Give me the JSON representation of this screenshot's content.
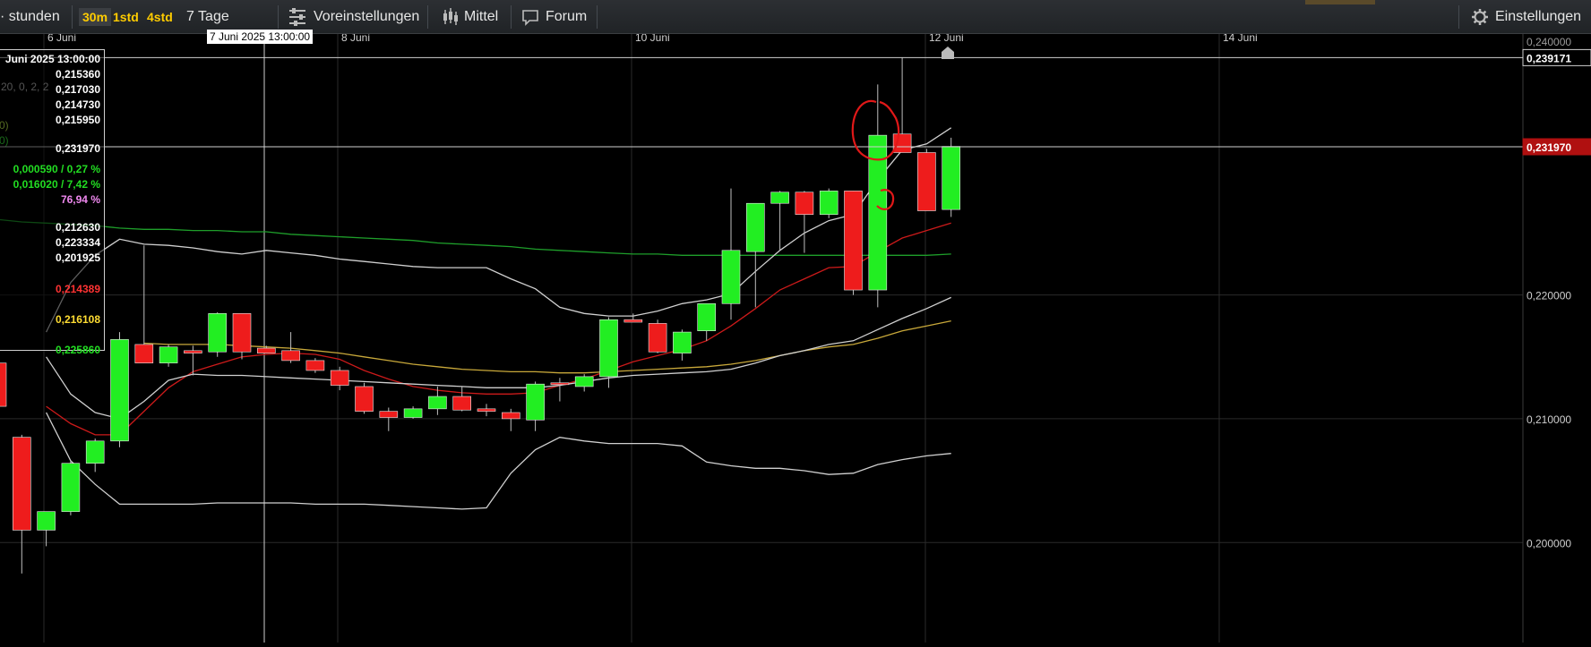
{
  "toolbar": {
    "left_label": "· stunden",
    "intervals": [
      {
        "label": "30m",
        "active": true
      },
      {
        "label": "1std",
        "active": false
      },
      {
        "label": "4std",
        "active": false
      }
    ],
    "range_label": "7 Tage",
    "presets_label": "Voreinstellungen",
    "average_label": "Mittel",
    "forum_label": "Forum",
    "settings_label": "Einstellungen"
  },
  "crosshair_label": "7 Juni 2025 13:00:00",
  "tooltip": {
    "date": "Juni 2025 13:00:00",
    "rows": [
      {
        "text": "0,215360",
        "color": "#ffffff"
      },
      {
        "text": "0,217030",
        "color": "#ffffff"
      },
      {
        "text": "0,214730",
        "color": "#ffffff"
      },
      {
        "text": "0,215950",
        "color": "#ffffff"
      },
      {
        "text": "0,231970",
        "color": "#ffffff"
      },
      {
        "text": "0,000590 / 0,27 %",
        "color": "#22dd22"
      },
      {
        "text": "0,016020 / 7,42 %",
        "color": "#22dd22"
      },
      {
        "text": "76,94 %",
        "color": "#ee88ee"
      },
      {
        "text": "0,212630",
        "color": "#ffffff"
      },
      {
        "text": "0,223334",
        "color": "#ffffff"
      },
      {
        "text": "0,201925",
        "color": "#ffffff"
      },
      {
        "text": "0,214389",
        "color": "#ff3333"
      },
      {
        "text": "0,216108",
        "color": "#ffdd33"
      },
      {
        "text": "0,225860",
        "color": "#22dd22"
      }
    ],
    "side_fragments": [
      "20, 0, 2, 2",
      "0)",
      "0)"
    ]
  },
  "chart_data": {
    "type": "candlestick",
    "x_ticks": [
      "6 Juni",
      "8 Juni",
      "10 Juni",
      "12 Juni",
      "14 Juni"
    ],
    "y_ticks": [
      "0,200000",
      "0,210000",
      "0,220000"
    ],
    "y_range": [
      0.1925,
      0.2405
    ],
    "price_labels": [
      {
        "text": "0,239171",
        "value": 0.239171,
        "style": "white"
      },
      {
        "text": "0,231970",
        "value": 0.23197,
        "style": "red"
      }
    ],
    "top_fragment": "0,240000",
    "candles": [
      {
        "o": 0.2145,
        "h": 0.2155,
        "l": 0.211,
        "c": 0.211
      },
      {
        "o": 0.2085,
        "h": 0.2087,
        "l": 0.1975,
        "c": 0.201
      },
      {
        "o": 0.201,
        "h": 0.2025,
        "l": 0.1997,
        "c": 0.2025
      },
      {
        "o": 0.2025,
        "h": 0.2066,
        "l": 0.2022,
        "c": 0.2064
      },
      {
        "o": 0.2064,
        "h": 0.2084,
        "l": 0.2057,
        "c": 0.2082
      },
      {
        "o": 0.2082,
        "h": 0.217,
        "l": 0.2077,
        "c": 0.2164
      },
      {
        "o": 0.216,
        "h": 0.224,
        "l": 0.2145,
        "c": 0.2145
      },
      {
        "o": 0.2145,
        "h": 0.216,
        "l": 0.2142,
        "c": 0.2158
      },
      {
        "o": 0.2155,
        "h": 0.2159,
        "l": 0.2135,
        "c": 0.2153
      },
      {
        "o": 0.2154,
        "h": 0.2186,
        "l": 0.215,
        "c": 0.2185
      },
      {
        "o": 0.2185,
        "h": 0.2185,
        "l": 0.2148,
        "c": 0.2154
      },
      {
        "o": 0.2157,
        "h": 0.2159,
        "l": 0.2153,
        "c": 0.2153
      },
      {
        "o": 0.2155,
        "h": 0.217,
        "l": 0.2145,
        "c": 0.2147
      },
      {
        "o": 0.2147,
        "h": 0.2149,
        "l": 0.2137,
        "c": 0.2139
      },
      {
        "o": 0.2139,
        "h": 0.2142,
        "l": 0.2123,
        "c": 0.2127
      },
      {
        "o": 0.2126,
        "h": 0.2129,
        "l": 0.2104,
        "c": 0.2106
      },
      {
        "o": 0.2106,
        "h": 0.2109,
        "l": 0.209,
        "c": 0.2101
      },
      {
        "o": 0.2101,
        "h": 0.211,
        "l": 0.21,
        "c": 0.2108
      },
      {
        "o": 0.2108,
        "h": 0.2126,
        "l": 0.2103,
        "c": 0.2118
      },
      {
        "o": 0.2118,
        "h": 0.2126,
        "l": 0.2106,
        "c": 0.2107
      },
      {
        "o": 0.2108,
        "h": 0.2112,
        "l": 0.2102,
        "c": 0.2106
      },
      {
        "o": 0.2105,
        "h": 0.2108,
        "l": 0.209,
        "c": 0.21
      },
      {
        "o": 0.2099,
        "h": 0.213,
        "l": 0.209,
        "c": 0.2128
      },
      {
        "o": 0.2129,
        "h": 0.2133,
        "l": 0.2114,
        "c": 0.2128
      },
      {
        "o": 0.2126,
        "h": 0.2136,
        "l": 0.2122,
        "c": 0.2134
      },
      {
        "o": 0.2134,
        "h": 0.2182,
        "l": 0.2125,
        "c": 0.218
      },
      {
        "o": 0.218,
        "h": 0.2185,
        "l": 0.2178,
        "c": 0.2178
      },
      {
        "o": 0.2177,
        "h": 0.218,
        "l": 0.2153,
        "c": 0.2154
      },
      {
        "o": 0.2153,
        "h": 0.2172,
        "l": 0.2147,
        "c": 0.217
      },
      {
        "o": 0.2171,
        "h": 0.2193,
        "l": 0.2163,
        "c": 0.2193
      },
      {
        "o": 0.2193,
        "h": 0.2286,
        "l": 0.218,
        "c": 0.2236
      },
      {
        "o": 0.2235,
        "h": 0.2258,
        "l": 0.219,
        "c": 0.2274
      },
      {
        "o": 0.2274,
        "h": 0.2284,
        "l": 0.2236,
        "c": 0.2283
      },
      {
        "o": 0.2283,
        "h": 0.2284,
        "l": 0.2234,
        "c": 0.2265
      },
      {
        "o": 0.2265,
        "h": 0.2286,
        "l": 0.2262,
        "c": 0.2284
      },
      {
        "o": 0.2284,
        "h": 0.2284,
        "l": 0.22,
        "c": 0.2204
      },
      {
        "o": 0.2204,
        "h": 0.237,
        "l": 0.219,
        "c": 0.2329
      },
      {
        "o": 0.233,
        "h": 0.2392,
        "l": 0.2316,
        "c": 0.2315
      },
      {
        "o": 0.2315,
        "h": 0.2318,
        "l": 0.2268,
        "c": 0.2268
      },
      {
        "o": 0.2269,
        "h": 0.2327,
        "l": 0.2263,
        "c": 0.232
      }
    ],
    "series": [
      {
        "type": "sma",
        "color": "#cc1a1a",
        "values": [
          null,
          null,
          0.211,
          0.2096,
          0.2087,
          0.2087,
          0.2106,
          0.2125,
          0.2138,
          0.2144,
          0.215,
          0.2152,
          0.2153,
          0.2152,
          0.2148,
          0.2139,
          0.2132,
          0.2126,
          0.2123,
          0.2121,
          0.212,
          0.212,
          0.2121,
          0.2127,
          0.2132,
          0.2139,
          0.2146,
          0.2151,
          0.2156,
          0.2163,
          0.2175,
          0.2189,
          0.2204,
          0.2213,
          0.2222,
          0.2223,
          0.2235,
          0.2246,
          0.2252,
          0.2258
        ]
      },
      {
        "type": "sma",
        "color": "#c8a83a",
        "values": [
          null,
          null,
          null,
          null,
          null,
          null,
          0.2161,
          0.216,
          0.216,
          0.216,
          0.2159,
          0.2158,
          0.2157,
          0.2155,
          0.2153,
          0.215,
          0.2147,
          0.2144,
          0.2142,
          0.214,
          0.2139,
          0.2138,
          0.2138,
          0.2137,
          0.2137,
          0.2138,
          0.2139,
          0.214,
          0.2141,
          0.2142,
          0.2144,
          0.2147,
          0.2151,
          0.2155,
          0.2158,
          0.216,
          0.2165,
          0.2171,
          0.2175,
          0.2179
        ]
      },
      {
        "type": "sma",
        "color": "#1e9e2a",
        "values": [
          0.2261,
          0.2259,
          0.2258,
          0.2257,
          0.2256,
          0.2254,
          0.2253,
          0.2253,
          0.2252,
          0.2252,
          0.2251,
          0.2251,
          0.2249,
          0.2248,
          0.2247,
          0.2246,
          0.2245,
          0.2244,
          0.2242,
          0.2241,
          0.224,
          0.2239,
          0.2237,
          0.2236,
          0.2235,
          0.2234,
          0.2233,
          0.2233,
          0.2232,
          0.2232,
          0.2232,
          0.2232,
          0.2232,
          0.2232,
          0.2232,
          0.2232,
          0.2232,
          0.2232,
          0.2232,
          0.2233
        ]
      },
      {
        "type": "bollinger_upper",
        "color": "#d0d0d0",
        "values": [
          null,
          null,
          0.217,
          0.221,
          0.2232,
          0.2245,
          0.2241,
          0.224,
          0.2238,
          0.2235,
          0.2233,
          0.2236,
          0.2234,
          0.2232,
          0.2229,
          0.2227,
          0.2225,
          0.2223,
          0.2222,
          0.2222,
          0.2222,
          0.2213,
          0.2205,
          0.219,
          0.2185,
          0.2183,
          0.2183,
          0.2187,
          0.2193,
          0.2196,
          0.2201,
          0.2219,
          0.2236,
          0.225,
          0.226,
          0.2265,
          0.2293,
          0.2317,
          0.2322,
          0.2335
        ]
      },
      {
        "type": "bollinger_middle",
        "color": "#d0d0d0",
        "values": [
          null,
          null,
          0.215,
          0.212,
          0.2105,
          0.21,
          0.2114,
          0.2131,
          0.2136,
          0.2135,
          0.2135,
          0.2134,
          0.2133,
          0.2132,
          0.2131,
          0.213,
          0.2129,
          0.2128,
          0.2127,
          0.2126,
          0.2125,
          0.2125,
          0.2125,
          0.2127,
          0.213,
          0.2133,
          0.2135,
          0.2136,
          0.2137,
          0.2138,
          0.214,
          0.2145,
          0.2151,
          0.2155,
          0.216,
          0.2163,
          0.2172,
          0.2181,
          0.2189,
          0.2198
        ]
      },
      {
        "type": "bollinger_lower",
        "color": "#d0d0d0",
        "values": [
          null,
          null,
          0.2105,
          0.2066,
          0.2047,
          0.2031,
          0.2031,
          0.2031,
          0.2031,
          0.2032,
          0.2032,
          0.2032,
          0.2032,
          0.2031,
          0.2031,
          0.2031,
          0.203,
          0.2029,
          0.2028,
          0.2027,
          0.2028,
          0.2056,
          0.2075,
          0.2085,
          0.2082,
          0.208,
          0.208,
          0.208,
          0.2078,
          0.2065,
          0.2062,
          0.206,
          0.206,
          0.2058,
          0.2055,
          0.2056,
          0.2063,
          0.2067,
          0.207,
          0.2072
        ]
      }
    ]
  }
}
